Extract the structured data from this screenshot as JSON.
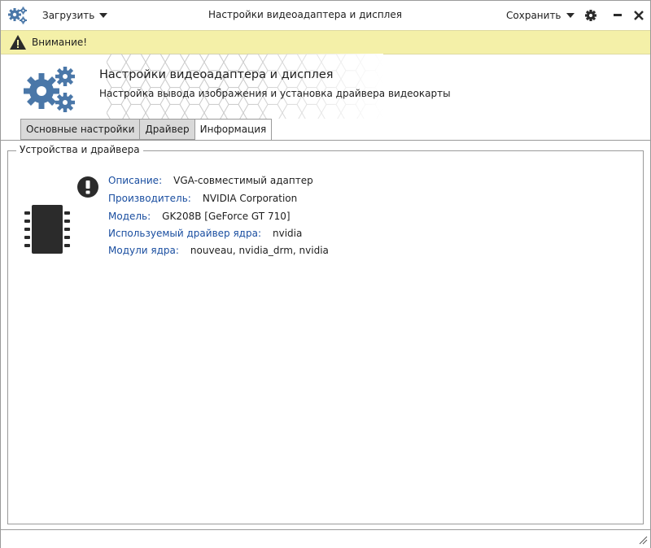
{
  "titlebar": {
    "load_label": "Загрузить",
    "title": "Настройки видеоадаптера и дисплея",
    "save_label": "Сохранить",
    "icons": [
      "app-gears-icon",
      "caret-down-icon",
      "gear-icon",
      "minimize-icon",
      "close-icon"
    ]
  },
  "warning": {
    "text": "Внимание!",
    "icon": "warning-triangle-icon",
    "color": "#f4f0a8"
  },
  "header": {
    "title": "Настройки видеоадаптера и дисплея",
    "subtitle": "Настройка вывода изображения и установка драйвера видеокарты",
    "icon": "gears-icon",
    "icon_color": "#4a77a8"
  },
  "tabs": [
    {
      "label": "Основные настройки",
      "active": false
    },
    {
      "label": "Драйвер",
      "active": false
    },
    {
      "label": "Информация",
      "active": true
    }
  ],
  "group": {
    "title": "Устройства и драйвера"
  },
  "device": {
    "icon": "chip-icon",
    "status_icon": "exclamation-icon",
    "fields": [
      {
        "label": "Описание:",
        "value": "VGA-совместимый адаптер"
      },
      {
        "label": "Производитель:",
        "value": "NVIDIA Corporation"
      },
      {
        "label": "Модель:",
        "value": "GK208B [GeForce GT 710]"
      },
      {
        "label": "Используемый драйвер ядра:",
        "value": "nvidia"
      },
      {
        "label": "Модули ядра:",
        "value": "nouveau, nvidia_drm, nvidia"
      }
    ],
    "label_color": "#1a4ea0"
  }
}
